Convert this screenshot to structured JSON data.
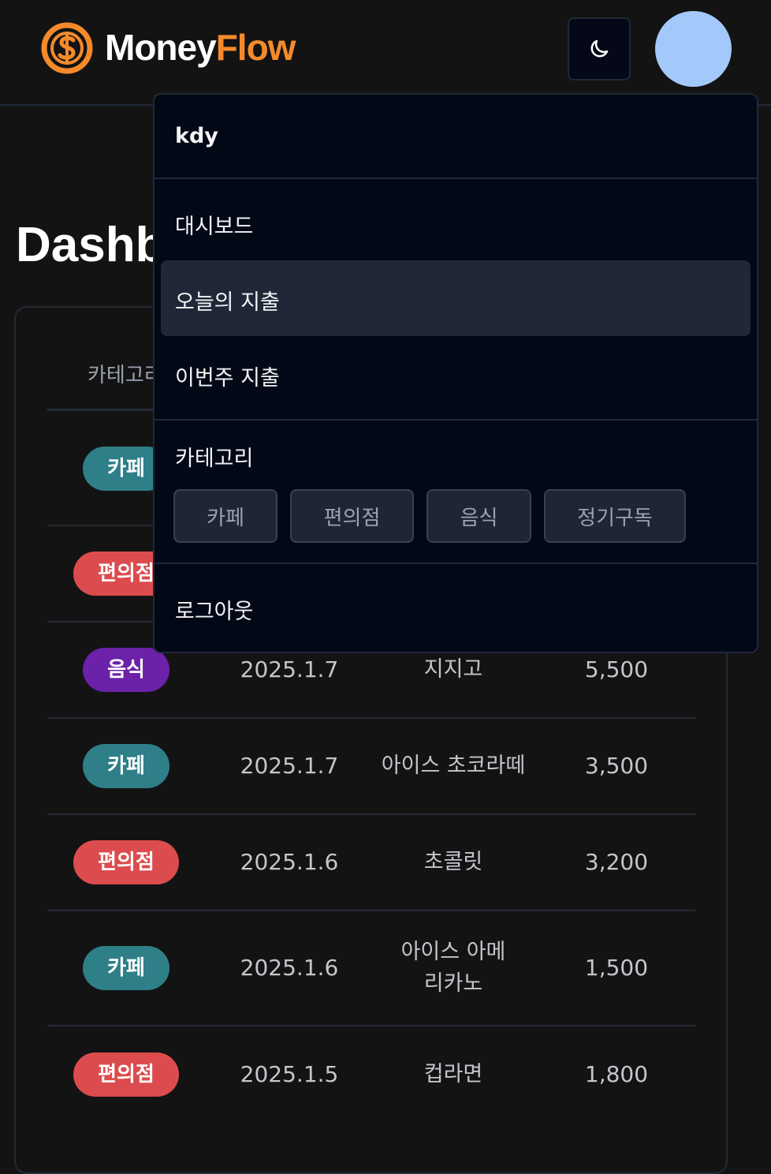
{
  "header": {
    "brand_part1": "Money",
    "brand_part2": "Flow",
    "logo_icon": "dollar-coin-icon",
    "theme_icon": "moon-icon"
  },
  "page": {
    "title": "Dashboard",
    "title_visible": "Dashb"
  },
  "table": {
    "header_visible": "카테고리",
    "rows": [
      {
        "category": "카페",
        "category_color": "#2e7f88",
        "date": "",
        "desc": "",
        "amount": ""
      },
      {
        "category": "편의점",
        "category_color": "#dc4c4e",
        "date": "",
        "desc": "",
        "amount": ""
      },
      {
        "category": "음식",
        "category_color": "#6b21a8",
        "date": "2025.1.7",
        "desc": "지지고",
        "amount": "5,500"
      },
      {
        "category": "카페",
        "category_color": "#2e7f88",
        "date": "2025.1.7",
        "desc": "아이스 초코라떼",
        "amount": "3,500"
      },
      {
        "category": "편의점",
        "category_color": "#dc4c4e",
        "date": "2025.1.6",
        "desc": "초콜릿",
        "amount": "3,200"
      },
      {
        "category": "카페",
        "category_color": "#2e7f88",
        "date": "2025.1.6",
        "desc": "아이스 아메리카노",
        "amount": "1,500"
      },
      {
        "category": "편의점",
        "category_color": "#dc4c4e",
        "date": "2025.1.5",
        "desc": "컵라면",
        "amount": "1,800"
      }
    ]
  },
  "dropdown": {
    "username": "kdy",
    "nav": [
      "대시보드",
      "오늘의 지출",
      "이번주 지출"
    ],
    "active_index": 1,
    "category_heading": "카테고리",
    "categories": [
      "카페",
      "편의점",
      "음식",
      "정기구독"
    ],
    "logout": "로그아웃"
  },
  "colors": {
    "background": "#131313",
    "accent": "#f58a2b",
    "avatar": "#a3c9fb",
    "dropdown_bg": "#030816"
  }
}
